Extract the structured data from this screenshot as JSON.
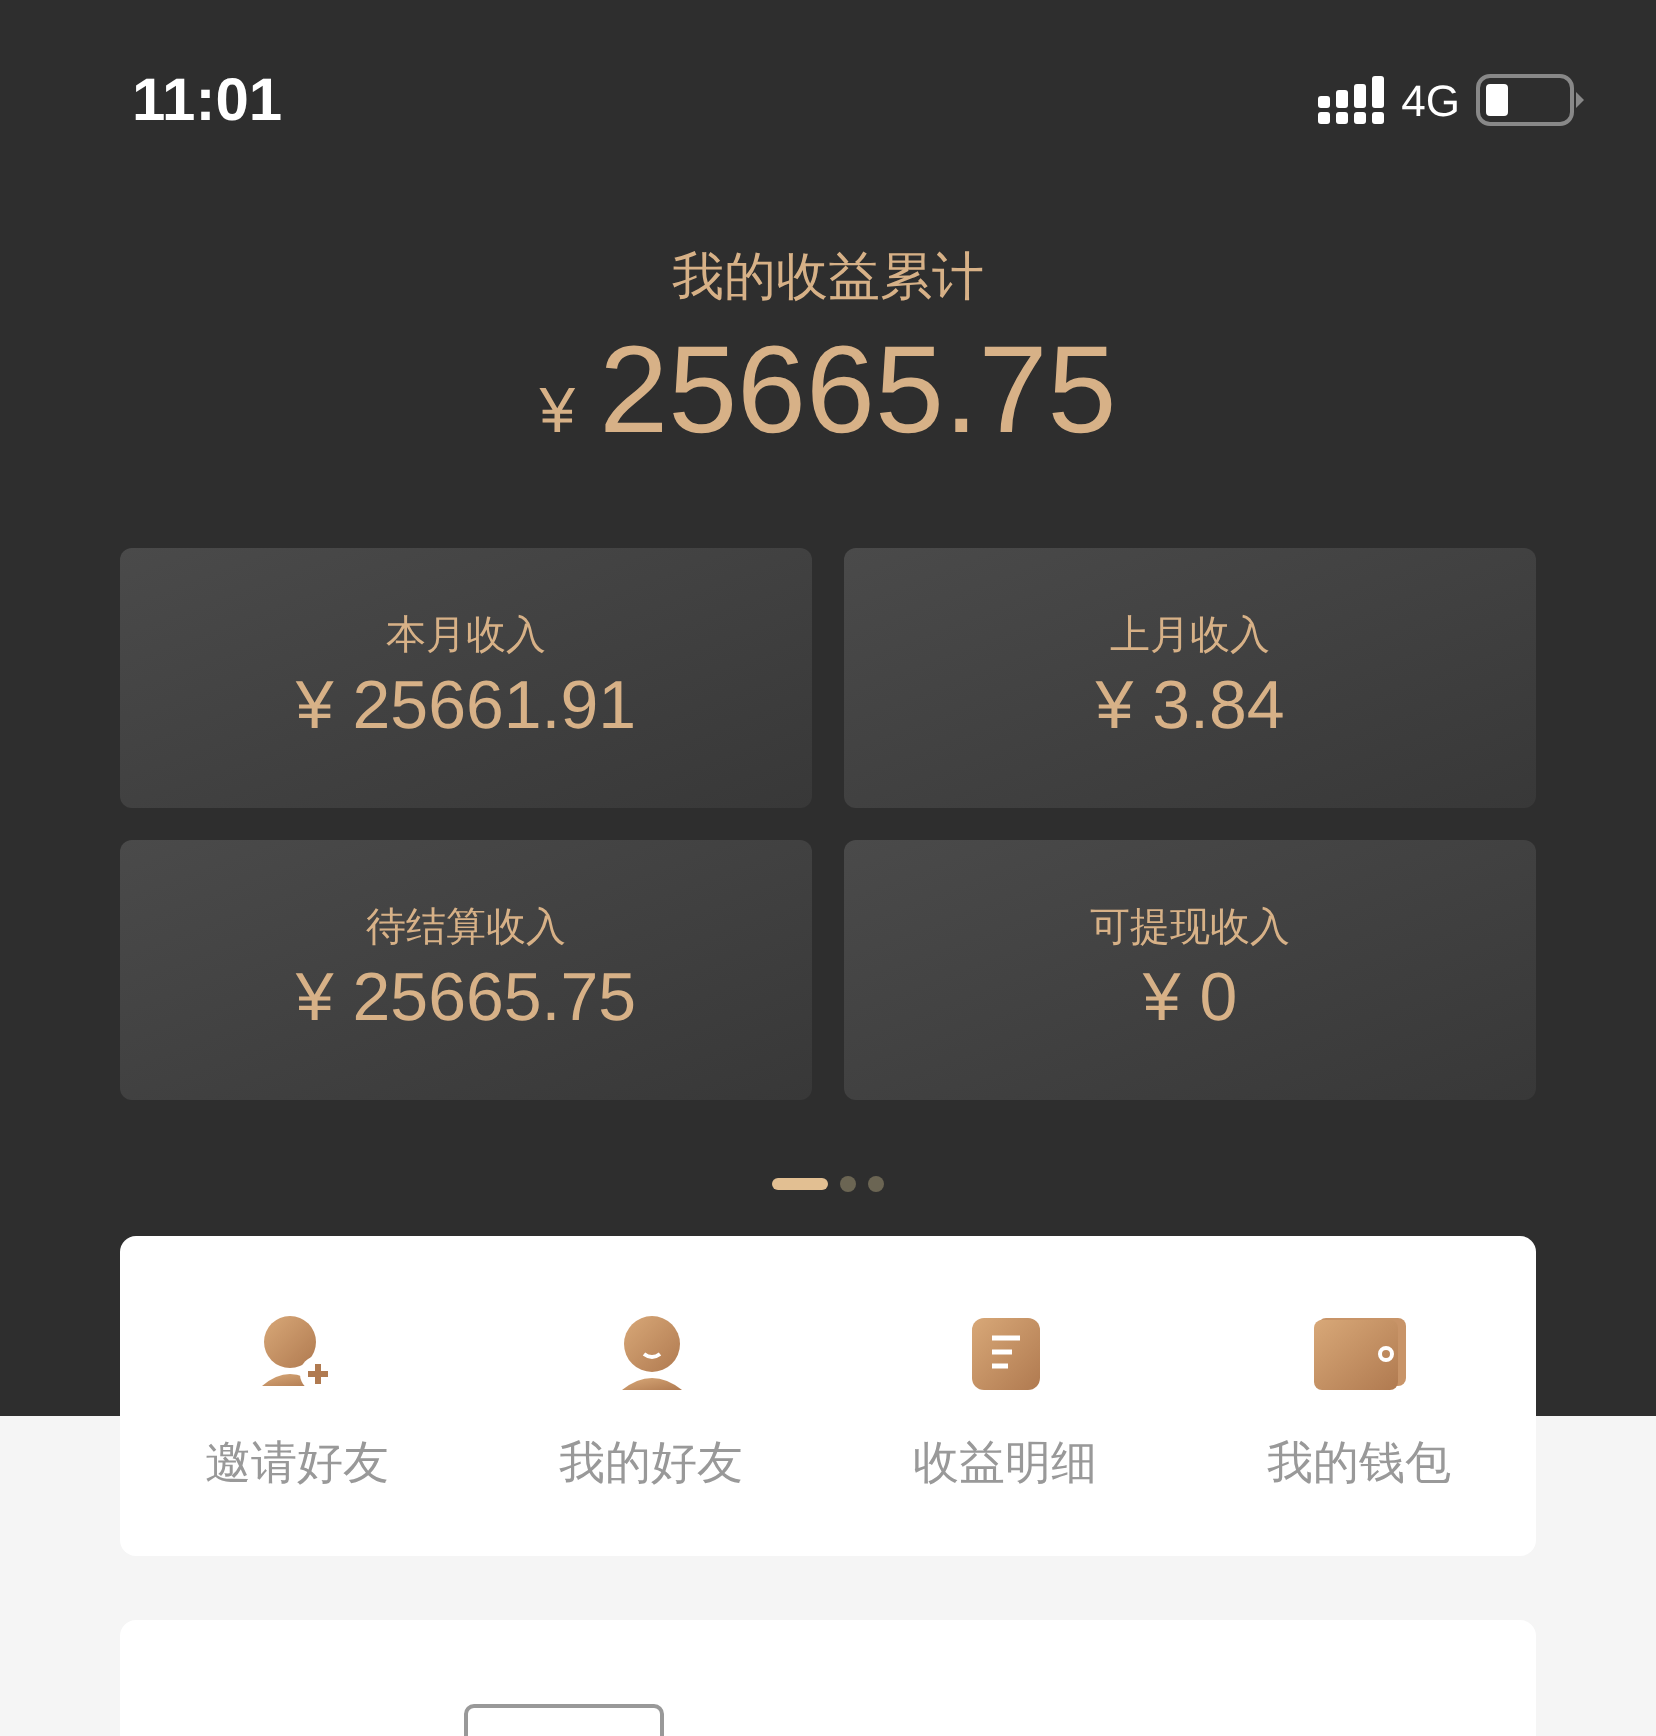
{
  "status_bar": {
    "time": "11:01",
    "network": "4G"
  },
  "summary": {
    "title": "我的收益累计",
    "currency": "¥",
    "amount": "25665.75"
  },
  "cards": [
    {
      "label": "本月收入",
      "value": "¥ 25661.91"
    },
    {
      "label": "上月收入",
      "value": "¥ 3.84"
    },
    {
      "label": "待结算收入",
      "value": "¥ 25665.75"
    },
    {
      "label": "可提现收入",
      "value": "¥ 0"
    }
  ],
  "pager": [
    {
      "selected": true
    },
    {
      "selected": false
    },
    {
      "selected": false
    }
  ],
  "actions": [
    {
      "kind": "invite",
      "label": "邀请好友"
    },
    {
      "kind": "friends",
      "label": "我的好友"
    },
    {
      "kind": "details",
      "label": "收益明细"
    },
    {
      "kind": "wallet",
      "label": "我的钱包"
    }
  ]
}
